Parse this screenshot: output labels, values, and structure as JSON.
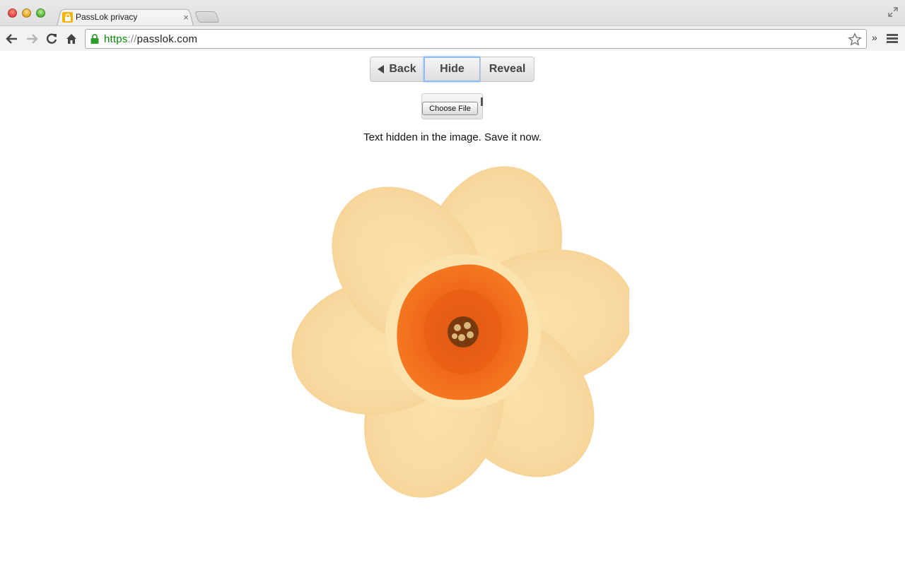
{
  "browser": {
    "tab_title": "PassLok privacy",
    "tab_close": "×",
    "url_scheme": "https",
    "url_separator": "://",
    "url_host": "passlok.com",
    "more_label": "»"
  },
  "page": {
    "buttons": {
      "back": "Back",
      "hide": "Hide",
      "reveal": "Reveal"
    },
    "file_button": "Choose File",
    "message": "Text hidden in the image. Save it now."
  },
  "colors": {
    "url_scheme": "#0a8a0a",
    "petal": "#f8d9a2",
    "corona": "#f06a1c",
    "focus_ring": "#8fbcef"
  }
}
